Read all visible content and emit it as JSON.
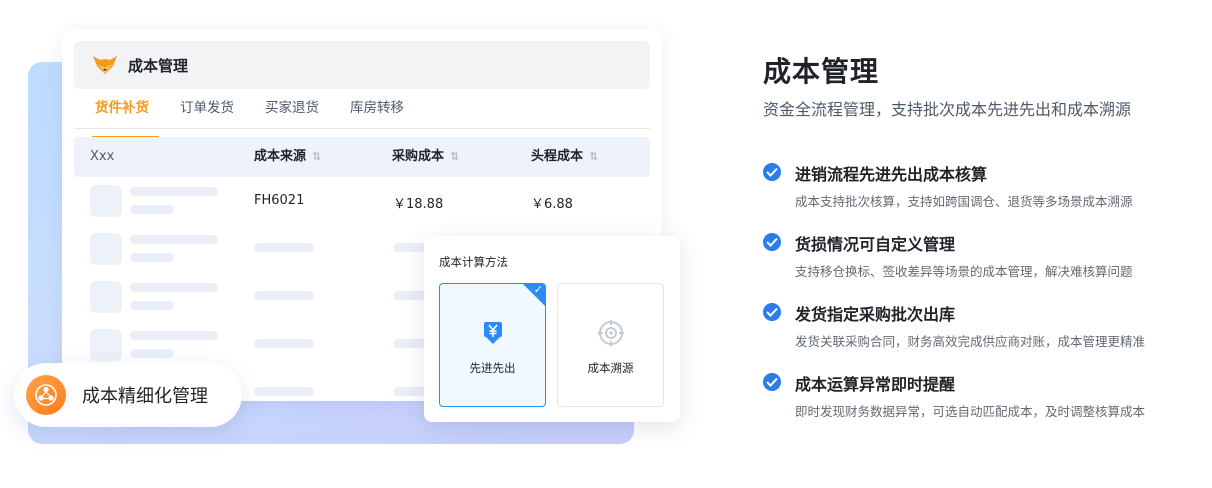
{
  "illustration": {
    "card_title": "成本管理",
    "tabs": [
      {
        "label": "货件补货",
        "active": true
      },
      {
        "label": "订单发货",
        "active": false
      },
      {
        "label": "买家退货",
        "active": false
      },
      {
        "label": "库房转移",
        "active": false
      }
    ],
    "table": {
      "columns": [
        "Xxx",
        "成本来源",
        "采购成本",
        "头程成本"
      ],
      "first_row": {
        "source": "FH6021",
        "purchase_cost": "￥18.88",
        "freight_cost": "￥6.88"
      }
    },
    "pill_label": "成本精细化管理",
    "popup": {
      "title": "成本计算方法",
      "options": [
        {
          "label": "先进先出",
          "selected": true,
          "icon": "yen-download-icon"
        },
        {
          "label": "成本溯源",
          "selected": false,
          "icon": "target-icon"
        }
      ]
    }
  },
  "content": {
    "title": "成本管理",
    "subtitle": "资金全流程管理，支持批次成本先进先出和成本溯源",
    "features": [
      {
        "title": "进销流程先进先出成本核算",
        "desc": "成本支持批次核算，支持如跨国调仓、退货等多场景成本溯源"
      },
      {
        "title": "货损情况可自定义管理",
        "desc": "支持移仓换标、签收差异等场景的成本管理，解决难核算问题"
      },
      {
        "title": "发货指定采购批次出库",
        "desc": "发货关联采购合同，财务高效完成供应商对账，成本管理更精准"
      },
      {
        "title": "成本运算异常即时提醒",
        "desc": "即时发现财务数据异常，可选自动匹配成本，及时调整核算成本"
      }
    ]
  },
  "colors": {
    "accent_orange": "#f59a1b",
    "accent_blue": "#2b8cf5"
  }
}
